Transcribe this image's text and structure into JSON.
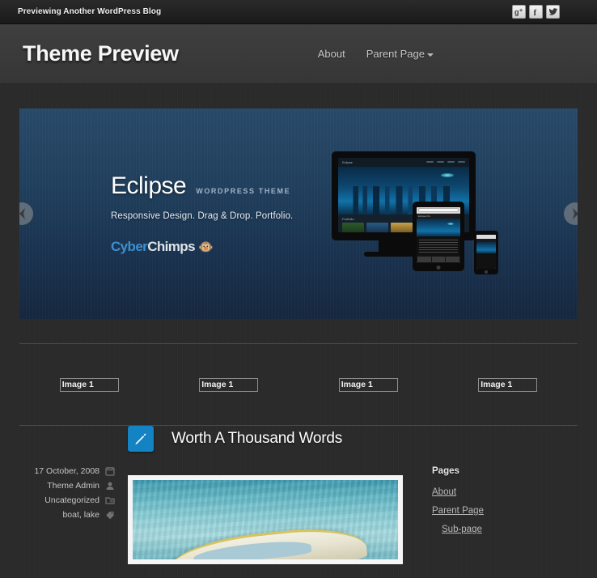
{
  "adminbar": {
    "title": "Previewing Another WordPress Blog",
    "social": [
      {
        "name": "google-plus-icon",
        "label": "g+"
      },
      {
        "name": "facebook-icon",
        "label": "f"
      },
      {
        "name": "twitter-icon",
        "label": "t"
      }
    ]
  },
  "header": {
    "site_title": "Theme Preview",
    "nav": [
      {
        "label": "About",
        "has_dropdown": false
      },
      {
        "label": "Parent Page",
        "has_dropdown": true
      }
    ]
  },
  "slider": {
    "heading": "Eclipse",
    "eyebrow": "WORDPRESS THEME",
    "tagline": "Responsive Design. Drag & Drop. Portfolio.",
    "brand_first": "Cyber",
    "brand_second": "Chimps",
    "prev_label": "Previous slide",
    "next_label": "Next slide",
    "mockup": {
      "desktop_logo": "Eclipse",
      "portfolio_label": "Portfolio",
      "tablet_logo": "Eclipse Pro",
      "phone_logo": "Eclipse Pro"
    }
  },
  "features": [
    {
      "alt": "Image 1"
    },
    {
      "alt": "Image 1"
    },
    {
      "alt": "Image 1"
    },
    {
      "alt": "Image 1"
    }
  ],
  "post": {
    "title": "Worth A Thousand Words",
    "icon": "pencil-icon",
    "accent_color": "#1383c4",
    "meta": [
      {
        "value": "17 October, 2008",
        "icon": "calendar-icon"
      },
      {
        "value": "Theme Admin",
        "icon": "user-icon"
      },
      {
        "value": "Uncategorized",
        "icon": "folder-icon"
      },
      {
        "value": "boat, lake",
        "icon": "tag-icon"
      }
    ],
    "image_alt": "boat on lake"
  },
  "sidebar": {
    "widget_title": "Pages",
    "links": [
      {
        "label": "About",
        "sub": false
      },
      {
        "label": "Parent Page",
        "sub": false
      },
      {
        "label": "Sub-page",
        "sub": true
      }
    ]
  }
}
